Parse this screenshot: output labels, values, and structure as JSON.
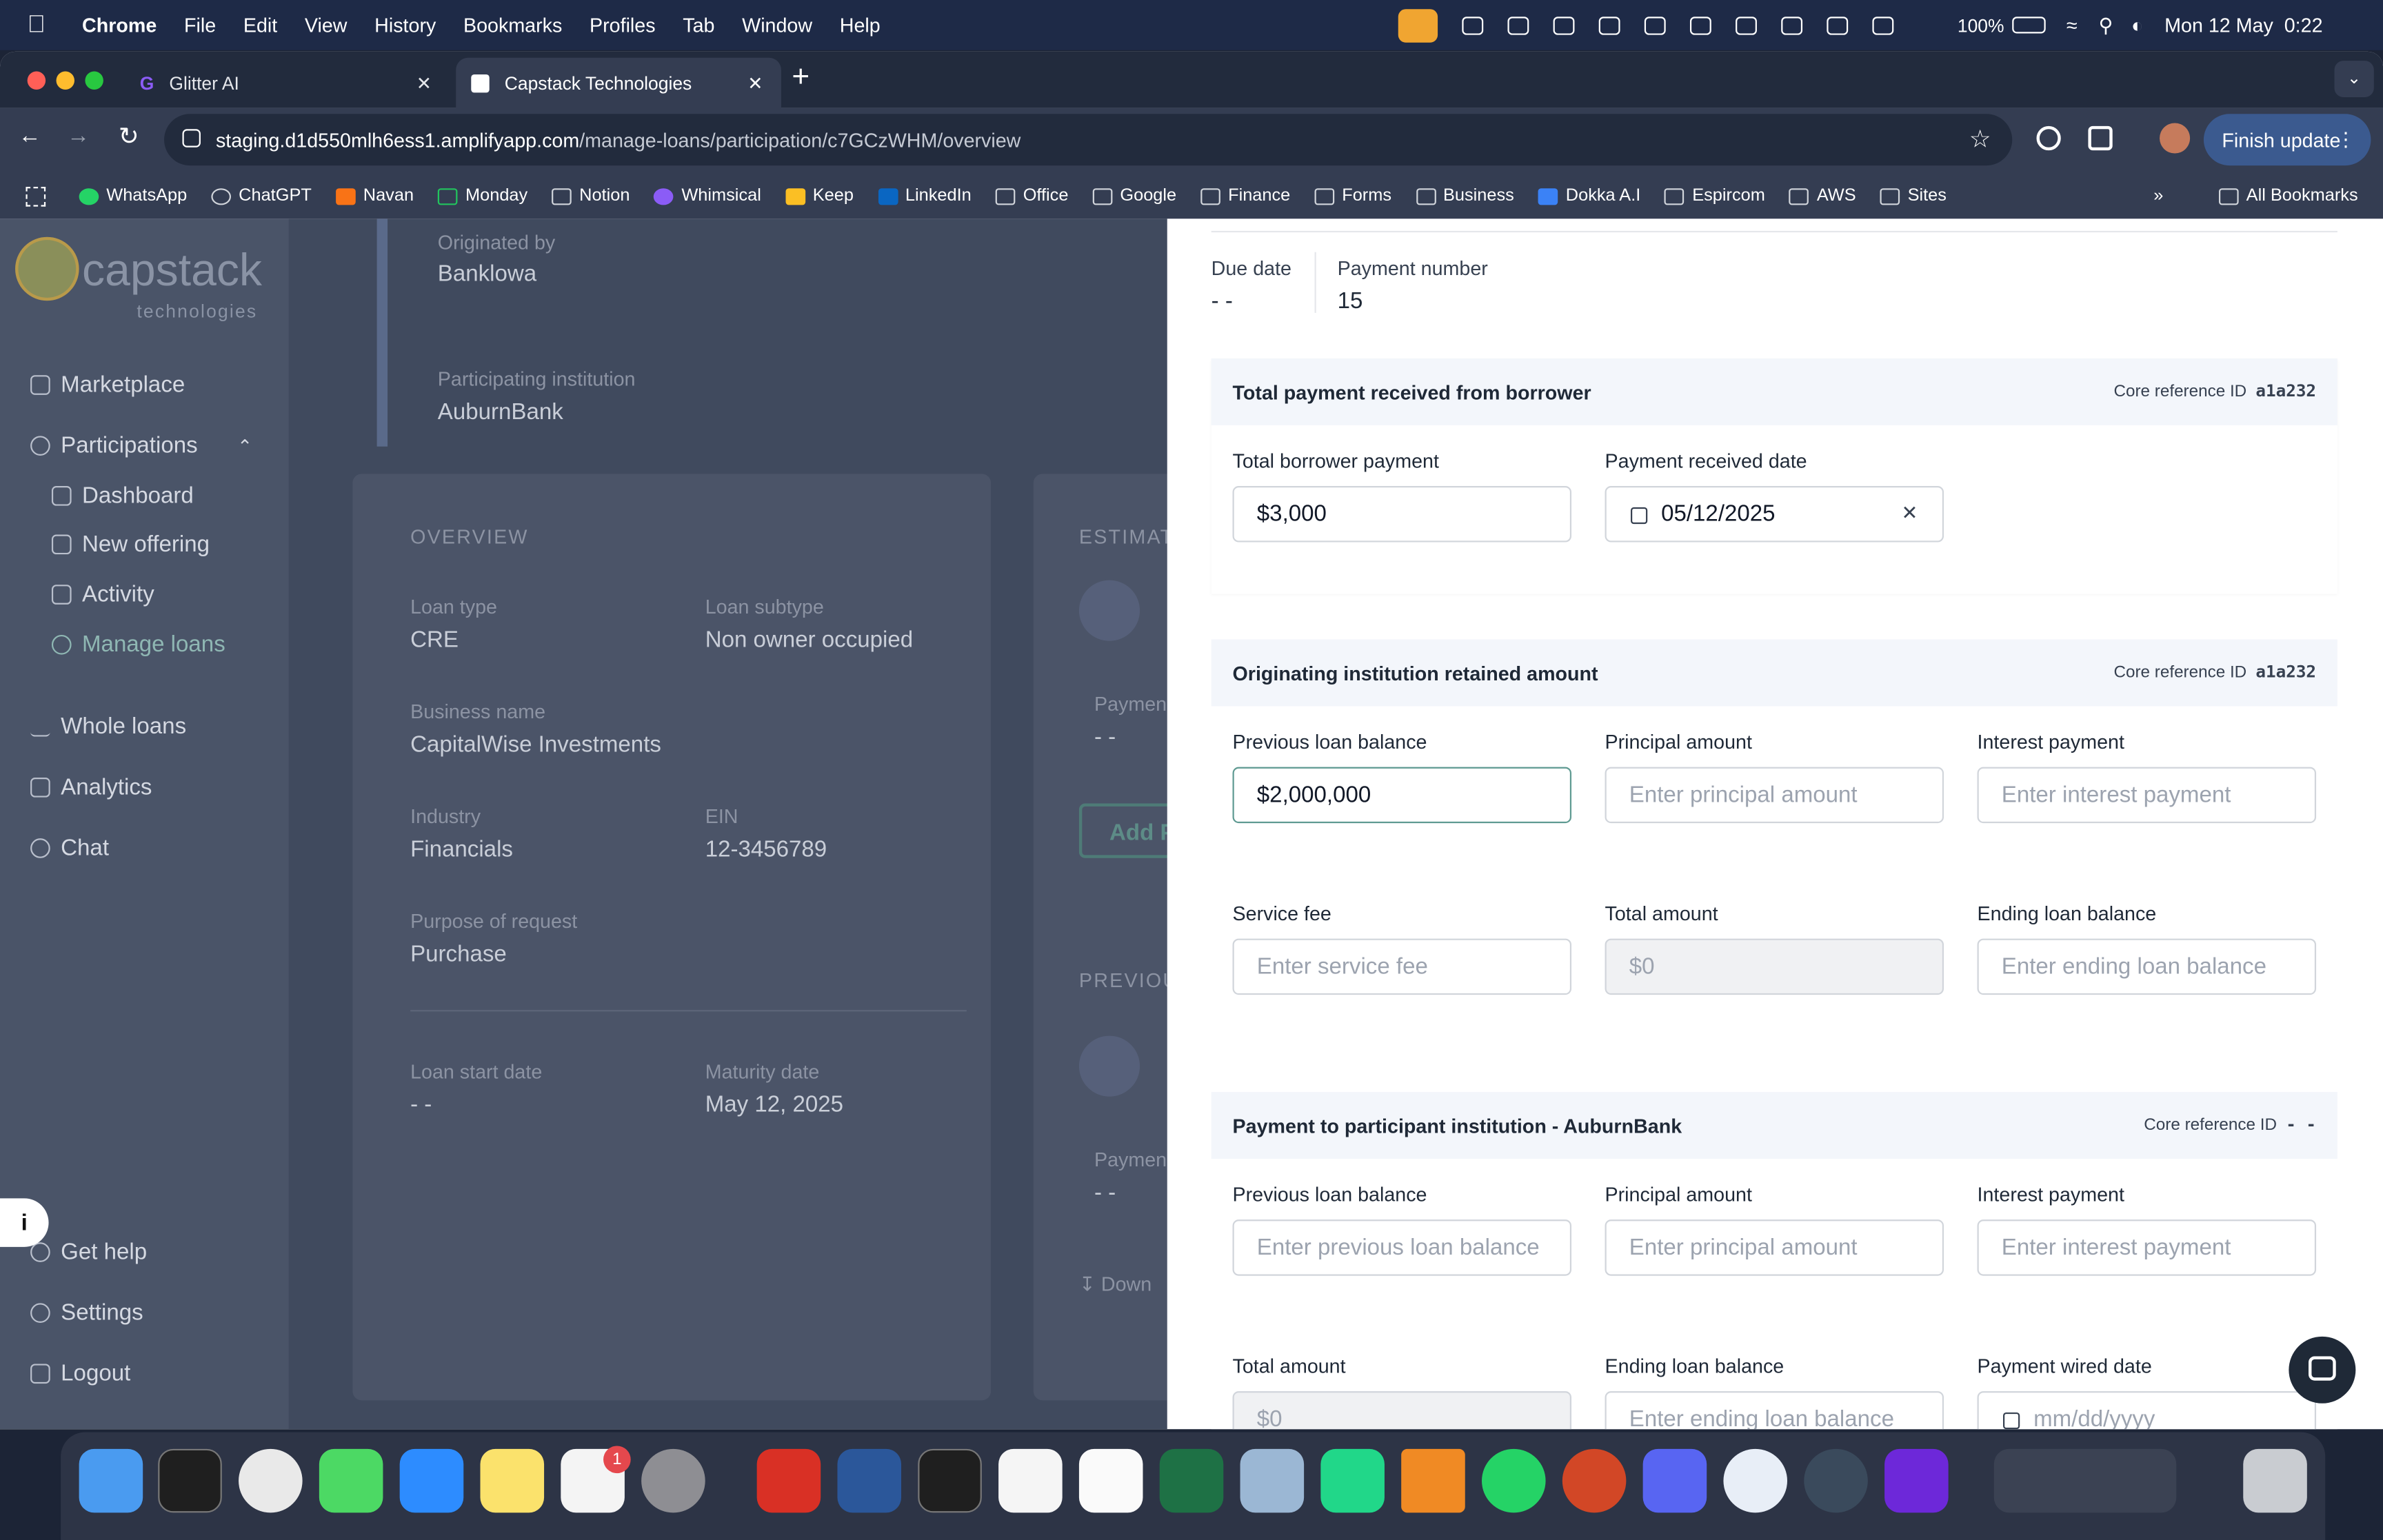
{
  "menubar": {
    "app": "Chrome",
    "items": [
      "File",
      "Edit",
      "View",
      "History",
      "Bookmarks",
      "Profiles",
      "Tab",
      "Window",
      "Help"
    ],
    "battery": "100%",
    "datetime": "Mon 12 May  0:22"
  },
  "browser": {
    "tabs": [
      {
        "label": "Glitter AI"
      },
      {
        "label": "Capstack Technologies"
      }
    ],
    "url_host": "staging.d1d550mlh6ess1.amplifyapp.com",
    "url_path": "/manage-loans/participation/c7GCzWHM/overview",
    "finish_update": "Finish update",
    "bookmarks": [
      "WhatsApp",
      "ChatGPT",
      "Navan",
      "Monday",
      "Notion",
      "Whimsical",
      "Keep",
      "LinkedIn",
      "Office",
      "Google",
      "Finance",
      "Forms",
      "Business",
      "Dokka A.I",
      "Espircom",
      "AWS",
      "Sites"
    ],
    "all_bookmarks": "All Bookmarks"
  },
  "sidebar": {
    "logo_text": "capstack",
    "logo_sub": "technologies",
    "items": {
      "marketplace": "Marketplace",
      "participations": "Participations",
      "dashboard": "Dashboard",
      "new_offering": "New offering",
      "activity": "Activity",
      "manage_loans": "Manage loans",
      "whole_loans": "Whole loans",
      "analytics": "Analytics",
      "chat": "Chat",
      "get_help": "Get help",
      "settings": "Settings",
      "logout": "Logout"
    }
  },
  "background_page": {
    "originated_by_label": "Originated by",
    "originated_by": "Banklowa",
    "participating_label": "Participating institution",
    "participating": "AuburnBank",
    "overview_title": "OVERVIEW",
    "estimate_title": "ESTIMAT",
    "loan_type_label": "Loan type",
    "loan_type": "CRE",
    "loan_subtype_label": "Loan subtype",
    "loan_subtype": "Non owner occupied",
    "business_name_label": "Business name",
    "business_name": "CapitalWise Investments",
    "industry_label": "Industry",
    "industry": "Financials",
    "ein_label": "EIN",
    "ein": "12-3456789",
    "purpose_label": "Purpose of request",
    "purpose": "Purchase",
    "loan_start_label": "Loan start date",
    "loan_start": "- -",
    "maturity_label": "Maturity date",
    "maturity": "May 12, 2025",
    "payment_label_1": "Paymen",
    "payment_val_1": "- -",
    "add_button": "Add P",
    "previous_title": "PREVIOU",
    "payment_label_2": "Paymen",
    "payment_val_2": "- -",
    "download": "Down"
  },
  "drawer": {
    "due_date_label": "Due date",
    "due_date": "- -",
    "payment_number_label": "Payment number",
    "payment_number": "15",
    "borrower": {
      "title": "Total payment received from borrower",
      "ref_label": "Core reference ID",
      "ref": "a1a232",
      "total_label": "Total borrower payment",
      "total_value": "$3,000",
      "date_label": "Payment received date",
      "date_value": "05/12/2025"
    },
    "originating": {
      "title": "Originating institution retained amount",
      "ref_label": "Core reference ID",
      "ref": "a1a232",
      "prev_label": "Previous loan balance",
      "prev_value": "$2,000,000",
      "principal_label": "Principal amount",
      "principal_ph": "Enter principal amount",
      "interest_label": "Interest payment",
      "interest_ph": "Enter interest payment",
      "service_label": "Service fee",
      "service_ph": "Enter service fee",
      "total_label": "Total amount",
      "total_value": "$0",
      "ending_label": "Ending loan balance",
      "ending_ph": "Enter ending loan balance"
    },
    "participant": {
      "title": "Payment to participant institution - AuburnBank",
      "ref_label": "Core reference ID",
      "ref": "- -",
      "prev_label": "Previous loan balance",
      "prev_ph": "Enter previous loan balance",
      "principal_label": "Principal amount",
      "principal_ph": "Enter principal amount",
      "interest_label": "Interest payment",
      "interest_ph": "Enter interest payment",
      "total_label": "Total amount",
      "total_value": "$0",
      "ending_label": "Ending loan balance",
      "ending_ph": "Enter ending loan balance",
      "wired_label": "Payment wired date",
      "wired_ph": "mm/dd/yyyy"
    }
  },
  "dock": {
    "slack_badge": "1"
  },
  "colors": {
    "accent": "#5f9a92",
    "section_header_bg": "#f3f6fb",
    "overlay": "#475066",
    "finish_button": "#3b5a8f"
  }
}
